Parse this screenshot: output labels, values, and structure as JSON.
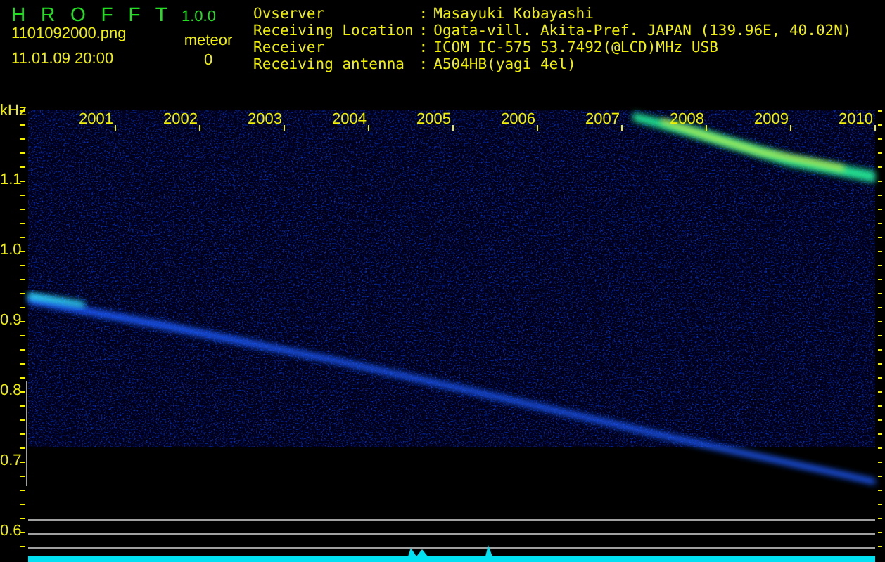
{
  "app": {
    "title": "H R O F F T",
    "version": "1.0.0",
    "file": "1101092000.png",
    "datetime": "11.01.09 20:00",
    "meteor_label": "meteor",
    "meteor_count": "0"
  },
  "info": [
    {
      "label": "Ovserver",
      "sep": ":",
      "value": "Masayuki Kobayashi"
    },
    {
      "label": "Receiving Location",
      "sep": ":",
      "value": "Ogata-vill. Akita-Pref. JAPAN (139.96E, 40.02N)"
    },
    {
      "label": "Receiver",
      "sep": ":",
      "value": "ICOM IC-575 53.7492(@LCD)MHz USB"
    },
    {
      "label": "Receiving antenna",
      "sep": ":",
      "value": "A504HB(yagi 4el)"
    }
  ],
  "plot": {
    "unit": "kHz",
    "y_labels": [
      "1.1",
      "1.0",
      "0.9",
      "0.8",
      "0.7",
      "0.6"
    ],
    "x_labels": [
      "2001",
      "2002",
      "2003",
      "2004",
      "2005",
      "2006",
      "2007",
      "2008",
      "2009",
      "2010"
    ]
  }
}
